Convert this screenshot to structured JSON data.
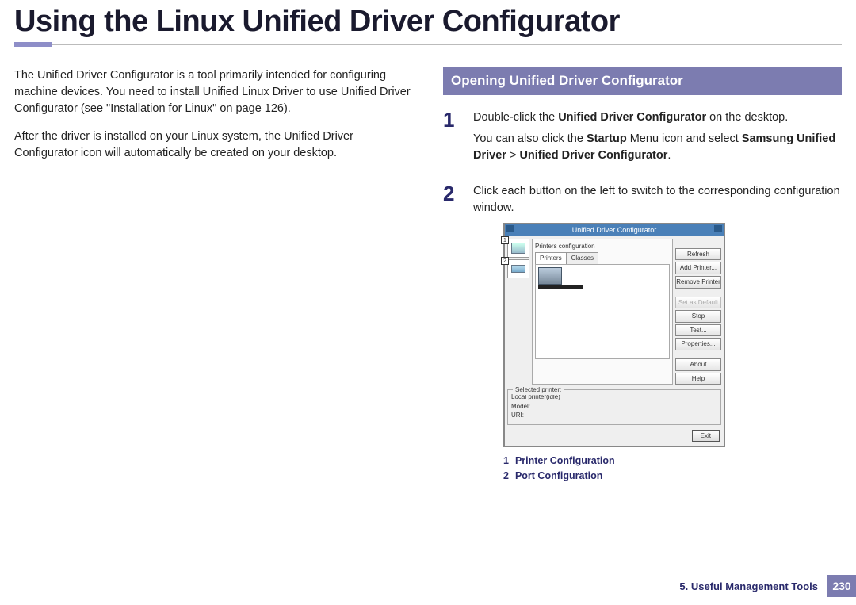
{
  "page_title": "Using the Linux Unified Driver Configurator",
  "left_column": {
    "p1": "The Unified Driver Configurator is a tool primarily intended for configuring machine devices. You need to install Unified Linux Driver to use Unified Driver Configurator (see \"Installation for Linux\" on page 126).",
    "p2": "After the driver is installed on your Linux system, the Unified Driver Configurator icon will automatically be created on your desktop."
  },
  "right_column": {
    "section_title": "Opening Unified Driver Configurator",
    "steps": [
      {
        "num": "1",
        "line1_pre": "Double-click the ",
        "line1_bold": "Unified Driver Configurator",
        "line1_post": " on the desktop.",
        "line2_pre": "You can also click the ",
        "line2_b1": "Startup",
        "line2_mid": " Menu icon and select ",
        "line2_b2": "Samsung Unified Driver",
        "line2_gt": " > ",
        "line2_b3": "Unified Driver Configurator",
        "line2_post": "."
      },
      {
        "num": "2",
        "text": "Click each button on the left to switch to the corresponding configuration window."
      }
    ]
  },
  "app": {
    "title": "Unified Driver Configurator",
    "section": "Printers configuration",
    "tabs": [
      "Printers",
      "Classes"
    ],
    "left_callouts": [
      "1",
      "2"
    ],
    "buttons": {
      "refresh": "Refresh",
      "add": "Add Printer...",
      "remove": "Remove Printer",
      "setdef": "Set as Default",
      "stop": "Stop",
      "test": "Test...",
      "props": "Properties...",
      "about": "About",
      "help": "Help"
    },
    "selected": {
      "legend": "Selected printer:",
      "l1": "Local printer(idle)",
      "l2": "Model:",
      "l3": "URI:"
    },
    "exit": "Exit"
  },
  "legend_below": [
    {
      "num": "1",
      "label": "Printer Configuration"
    },
    {
      "num": "2",
      "label": "Port Configuration"
    }
  ],
  "footer": {
    "chapter": "5.  Useful Management Tools",
    "page": "230"
  }
}
